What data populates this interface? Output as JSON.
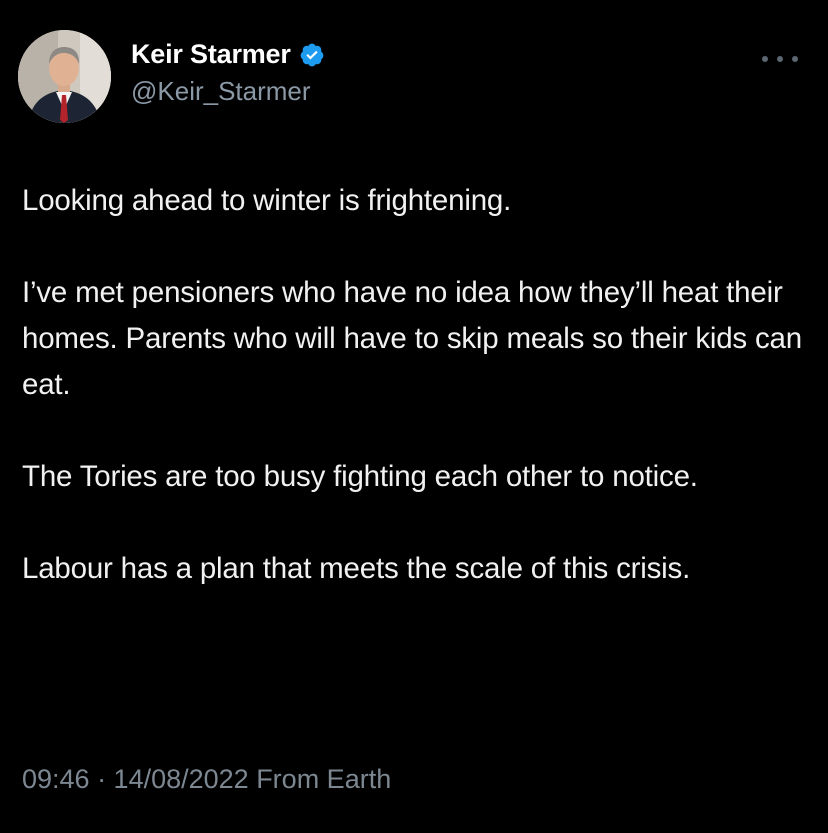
{
  "author": {
    "display_name": "Keir Starmer",
    "handle": "@Keir_Starmer",
    "verified": true,
    "verified_color": "#1d9bf0",
    "avatar_icon": "profile-photo"
  },
  "menu": {
    "icon": "more-options-icon"
  },
  "tweet": {
    "paragraphs": [
      "Looking ahead to winter is frightening.",
      "I’ve met pensioners who have no idea how they’ll heat their homes. Parents who will have to skip meals so their kids can eat.",
      "The Tories are too busy fighting each other to notice.",
      "Labour has a plan that meets the scale of this crisis."
    ],
    "timestamp": "09:46 · 14/08/2022 From Earth"
  },
  "colors": {
    "background": "#000000",
    "text": "#f1f1f1",
    "secondary_text": "#8b98a5"
  }
}
